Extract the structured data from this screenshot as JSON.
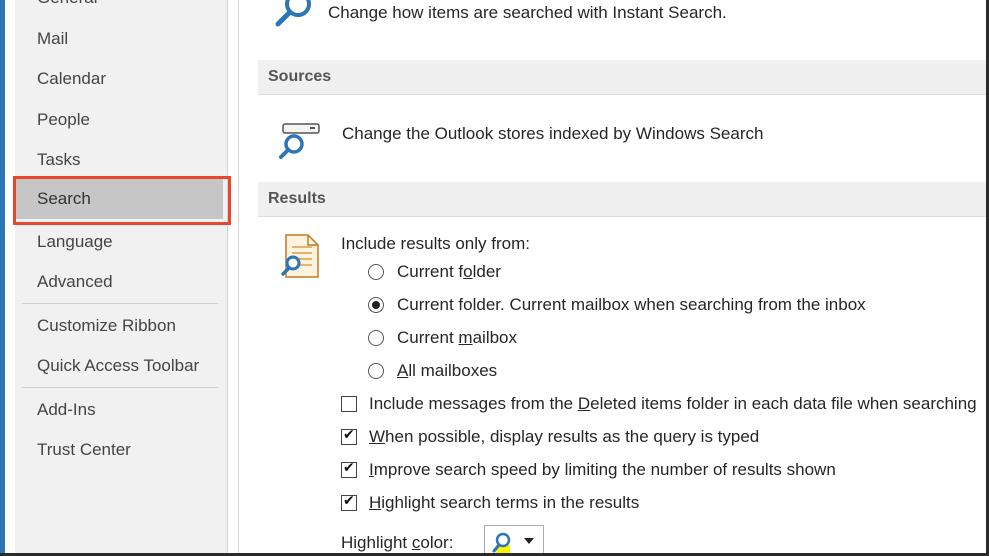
{
  "sidebar": {
    "items": [
      {
        "label": "General"
      },
      {
        "label": "Mail"
      },
      {
        "label": "Calendar"
      },
      {
        "label": "People"
      },
      {
        "label": "Tasks"
      },
      {
        "label": "Search"
      },
      {
        "label": "Language"
      },
      {
        "label": "Advanced"
      },
      {
        "label": "Customize Ribbon"
      },
      {
        "label": "Quick Access Toolbar"
      },
      {
        "label": "Add-Ins"
      },
      {
        "label": "Trust Center"
      }
    ],
    "selected": "Search"
  },
  "top": {
    "description": "Change how items are searched with Instant Search."
  },
  "sources": {
    "header": "Sources",
    "description": "Change the Outlook stores indexed by Windows Search"
  },
  "results": {
    "header": "Results",
    "include_label": "Include results only from:",
    "radios": [
      {
        "pre": "Current f",
        "u": "o",
        "post": "lder",
        "checked": false
      },
      {
        "pre": "Current folder. Current mailbox when searching from the inbox",
        "u": "",
        "post": "",
        "checked": true
      },
      {
        "pre": "Current ",
        "u": "m",
        "post": "ailbox",
        "checked": false
      },
      {
        "pre": "",
        "u": "A",
        "post": "ll mailboxes",
        "checked": false
      }
    ],
    "checkboxes": [
      {
        "pre": "Include messages from the ",
        "u": "D",
        "post": "eleted items folder in each data file when searching",
        "checked": false
      },
      {
        "pre": "",
        "u": "W",
        "post": "hen possible, display results as the query is typed",
        "checked": true
      },
      {
        "pre": "",
        "u": "I",
        "post": "mprove search speed by limiting the number of results shown",
        "checked": true
      },
      {
        "pre": "",
        "u": "H",
        "post": "ighlight search terms in the results",
        "checked": true
      }
    ],
    "highlight_color": {
      "pre": "Highlight ",
      "u": "c",
      "post": "olor:"
    }
  },
  "colors": {
    "selection_outline": "#e8462f",
    "accent": "#2e75b6"
  }
}
